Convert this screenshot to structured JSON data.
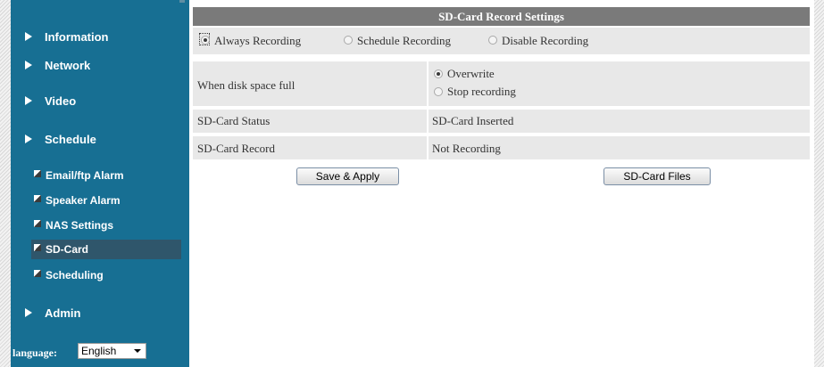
{
  "sidebar": {
    "nav": [
      {
        "label": "Information"
      },
      {
        "label": "Network"
      },
      {
        "label": "Video"
      },
      {
        "label": "Schedule"
      }
    ],
    "schedule_items": [
      {
        "label": "Email/ftp Alarm"
      },
      {
        "label": "Speaker Alarm"
      },
      {
        "label": "NAS Settings"
      },
      {
        "label": "SD-Card",
        "active": true
      },
      {
        "label": "Scheduling"
      }
    ],
    "admin": {
      "label": "Admin"
    },
    "language": {
      "label": "language:",
      "value": "English"
    },
    "colors": {
      "background": "#176f93",
      "active_item": "#2f566b"
    }
  },
  "main": {
    "title": "SD-Card Record Settings",
    "modes": [
      {
        "label": "Always Recording",
        "checked": true
      },
      {
        "label": "Schedule Recording",
        "checked": false
      },
      {
        "label": "Disable Recording",
        "checked": false
      }
    ],
    "disk_full": {
      "label": "When disk space full",
      "options": [
        {
          "label": "Overwrite",
          "checked": true
        },
        {
          "label": "Stop recording",
          "checked": false
        }
      ]
    },
    "status": {
      "label": "SD-Card Status",
      "value": "SD-Card Inserted"
    },
    "record": {
      "label": "SD-Card Record",
      "value": "Not Recording"
    },
    "buttons": {
      "save": "Save & Apply",
      "files": "SD-Card Files"
    },
    "colors": {
      "title_bar": "#7a7a7a",
      "row_bg": "#e8e8e8"
    }
  }
}
